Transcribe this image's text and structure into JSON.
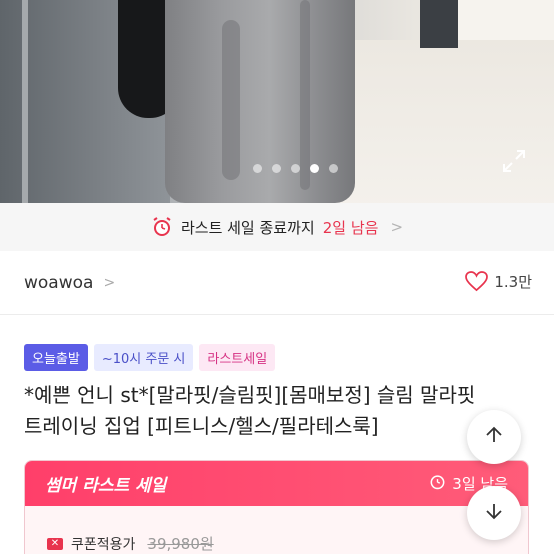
{
  "gallery": {
    "dots": [
      false,
      false,
      false,
      true,
      false
    ],
    "expand_icon": "expand-icon"
  },
  "sale_banner": {
    "icon": "alarm-clock-icon",
    "text": "라스트 세일 종료까지",
    "remaining": "2일 남음",
    "arrow": ">"
  },
  "shop": {
    "name": "woawoa",
    "chevron": ">",
    "like_icon": "heart-icon",
    "like_count": "1.3만"
  },
  "badges": [
    {
      "label": "오늘출발"
    },
    {
      "label": "~10시 주문 시"
    },
    {
      "label": "라스트세일"
    }
  ],
  "product": {
    "title_line1": "*예쁜 언니 st*[말라핏/슬림핏][몸매보정] 슬림 말라핏",
    "title_line2": "트레이닝 집업 [피트니스/헬스/필라테스룩]"
  },
  "summer_sale": {
    "title": "썸머 라스트 세일",
    "days_left": "3일 남음",
    "coupon_label": "쿠폰적용가",
    "original_price": "39,980원"
  },
  "colors": {
    "accent": "#e8344e",
    "badge_blue": "#5b5ce6"
  }
}
